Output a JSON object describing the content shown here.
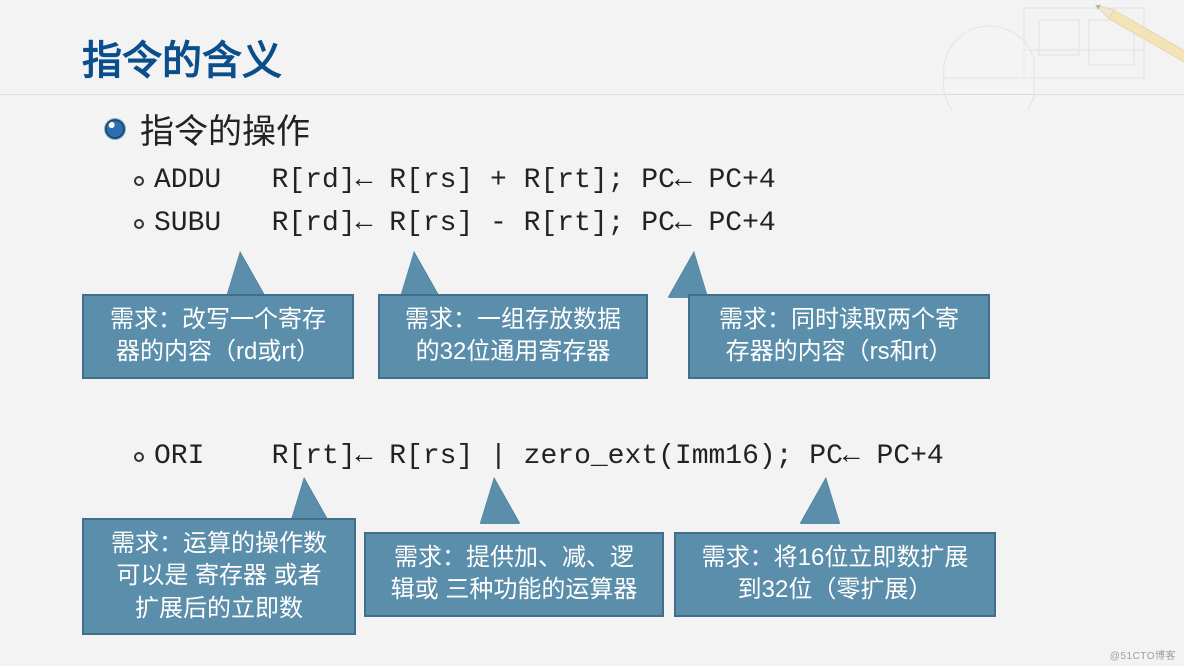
{
  "title": "指令的含义",
  "section_title": "指令的操作",
  "instructions": {
    "addu": "ADDU   R[rd]← R[rs] + R[rt]; PC← PC+4",
    "subu": "SUBU   R[rd]← R[rs] - R[rt]; PC← PC+4",
    "ori": "ORI    R[rt]← R[rs] | zero_ext(Imm16); PC← PC+4"
  },
  "callouts_top": [
    {
      "l1": "需求：改写一个寄存",
      "l2": "器的内容（rd或rt）"
    },
    {
      "l1": "需求：一组存放数据",
      "l2": "的32位通用寄存器"
    },
    {
      "l1": "需求：同时读取两个寄",
      "l2": "存器的内容（rs和rt）"
    }
  ],
  "callouts_bottom": [
    {
      "l1": "需求：运算的操作数",
      "l2": "可以是 寄存器 或者",
      "l3": "扩展后的立即数"
    },
    {
      "l1": "需求：提供加、减、逻",
      "l2": "辑或 三种功能的运算器"
    },
    {
      "l1": "需求：将16位立即数扩展",
      "l2": "到32位（零扩展）"
    }
  ],
  "watermark": "@51CTO博客"
}
